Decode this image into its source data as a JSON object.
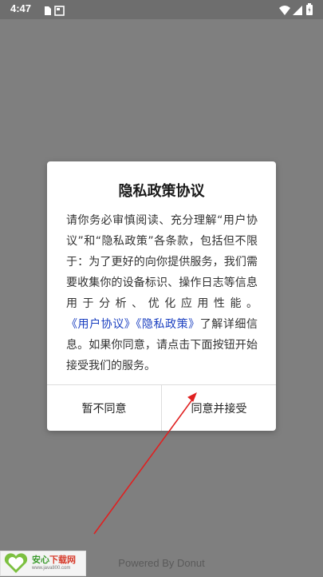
{
  "status_bar": {
    "time": "4:47",
    "left_icons": [
      "sim-card-icon",
      "image-icon"
    ],
    "right_icons": [
      "wifi-icon",
      "signal-icon",
      "battery-icon"
    ]
  },
  "dialog": {
    "title": "隐私政策协议",
    "body_text_1": "请你务必审慎阅读、充分理解“用户协议”和“隐私政策”各条款，包括但不限于：为了更好的向你提供服务，我们需要收集你的设备标识、操作日志等信息用于分析、优化应用性能。",
    "link_user_agreement": "《用户协议》",
    "link_privacy_policy": "《隐私政策》",
    "body_text_2": "了解详细信息。如果你同意，请点击下面按钮开始接受我们的服务。",
    "decline_label": "暂不同意",
    "accept_label": "同意并接受"
  },
  "footer": {
    "powered_by": "Powered By Donut"
  },
  "watermark": {
    "name_part1": "安心",
    "name_part2": "下载网",
    "url": "www.java800.com"
  },
  "colors": {
    "overlay": "#7f7f7f",
    "link": "#1a3fc0",
    "arrow": "#e02020"
  }
}
